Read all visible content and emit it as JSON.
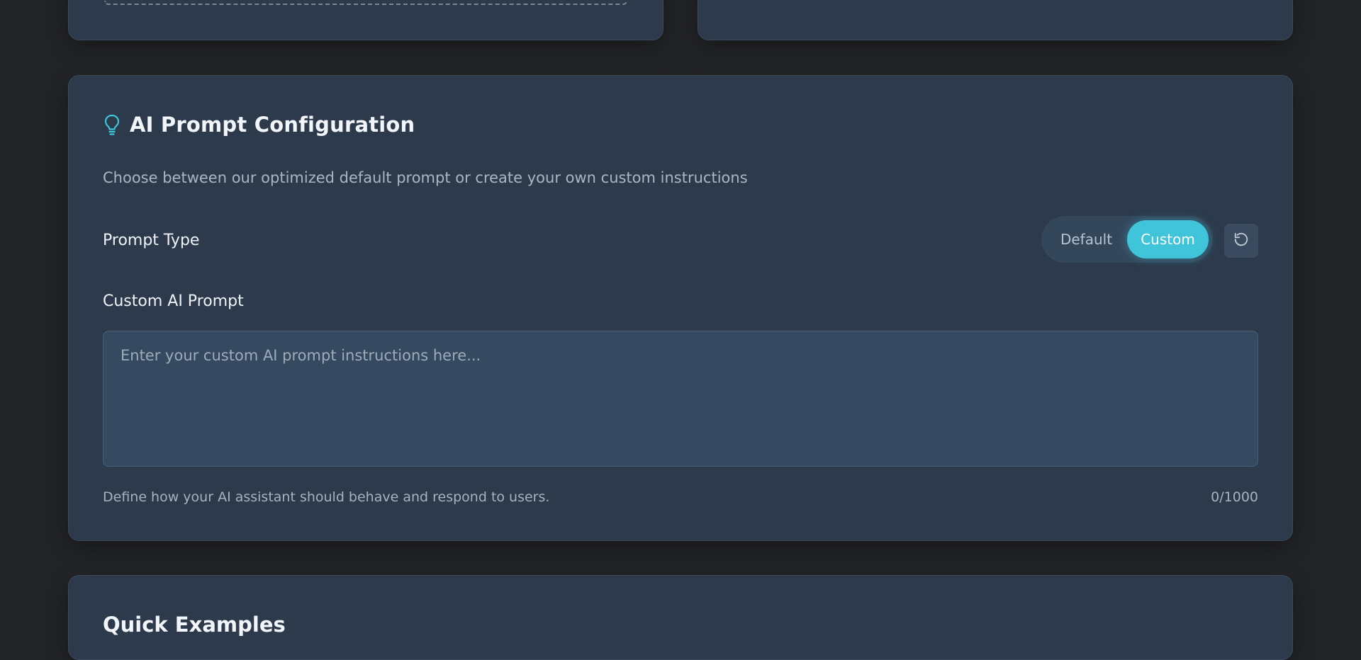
{
  "ai_prompt_config": {
    "title": "AI Prompt Configuration",
    "description": "Choose between our optimized default prompt or create your own custom instructions",
    "prompt_type_label": "Prompt Type",
    "segments": {
      "default_label": "Default",
      "custom_label": "Custom",
      "selected": "Custom"
    },
    "custom_prompt_label": "Custom AI Prompt",
    "textarea": {
      "value": "",
      "placeholder": "Enter your custom AI prompt instructions here..."
    },
    "helper_text": "Define how your AI assistant should behave and respond to users.",
    "char_count": "0/1000"
  },
  "quick_examples": {
    "title": "Quick Examples"
  },
  "icons": {
    "title_icon": "lightbulb-icon",
    "reset_icon": "rotate-ccw-icon"
  },
  "colors": {
    "accent": "#3fc4d9",
    "card_background": "#2c3a4b",
    "page_background": "#232426"
  }
}
